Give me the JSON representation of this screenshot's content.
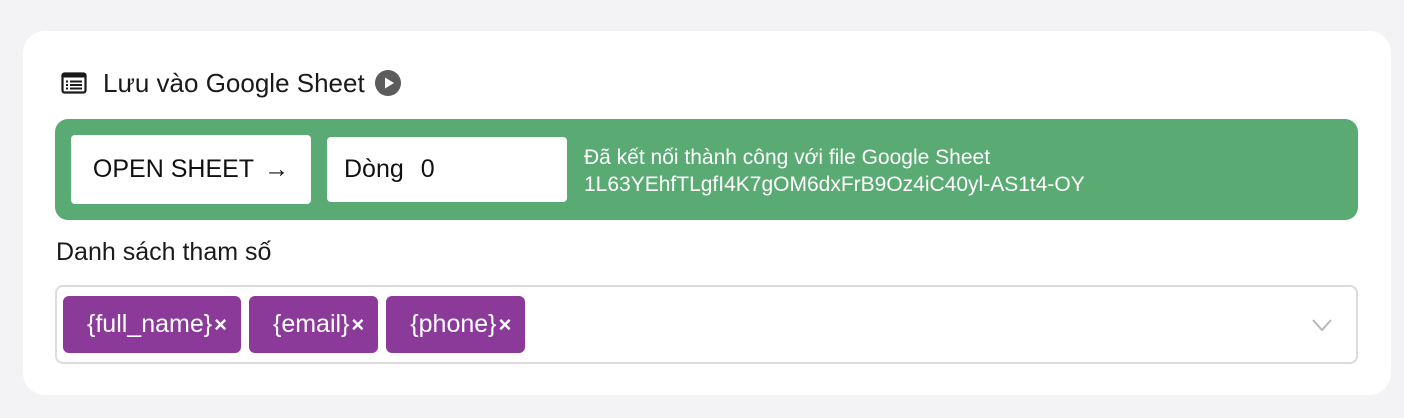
{
  "header": {
    "title": "Lưu vào Google Sheet",
    "icon": "sheet-list-icon",
    "play_icon": "play-circle-icon"
  },
  "banner": {
    "background": "#5aaa73",
    "open_button_label": "OPEN SHEET",
    "open_button_arrow": "→",
    "row_label": "Dòng",
    "row_value": "0",
    "message_line1": "Đã kết nối thành công với file Google Sheet",
    "message_line2": "1L63YEhfTLgfI4K7gOM6dxFrB9Oz4iC40yl-AS1t4-OY"
  },
  "params": {
    "label": "Danh sách tham số",
    "tag_color": "#8b3a9a",
    "tags": [
      {
        "label": "{full_name}",
        "remove": "×"
      },
      {
        "label": "{email}",
        "remove": "×"
      },
      {
        "label": "{phone}",
        "remove": "×"
      }
    ]
  }
}
